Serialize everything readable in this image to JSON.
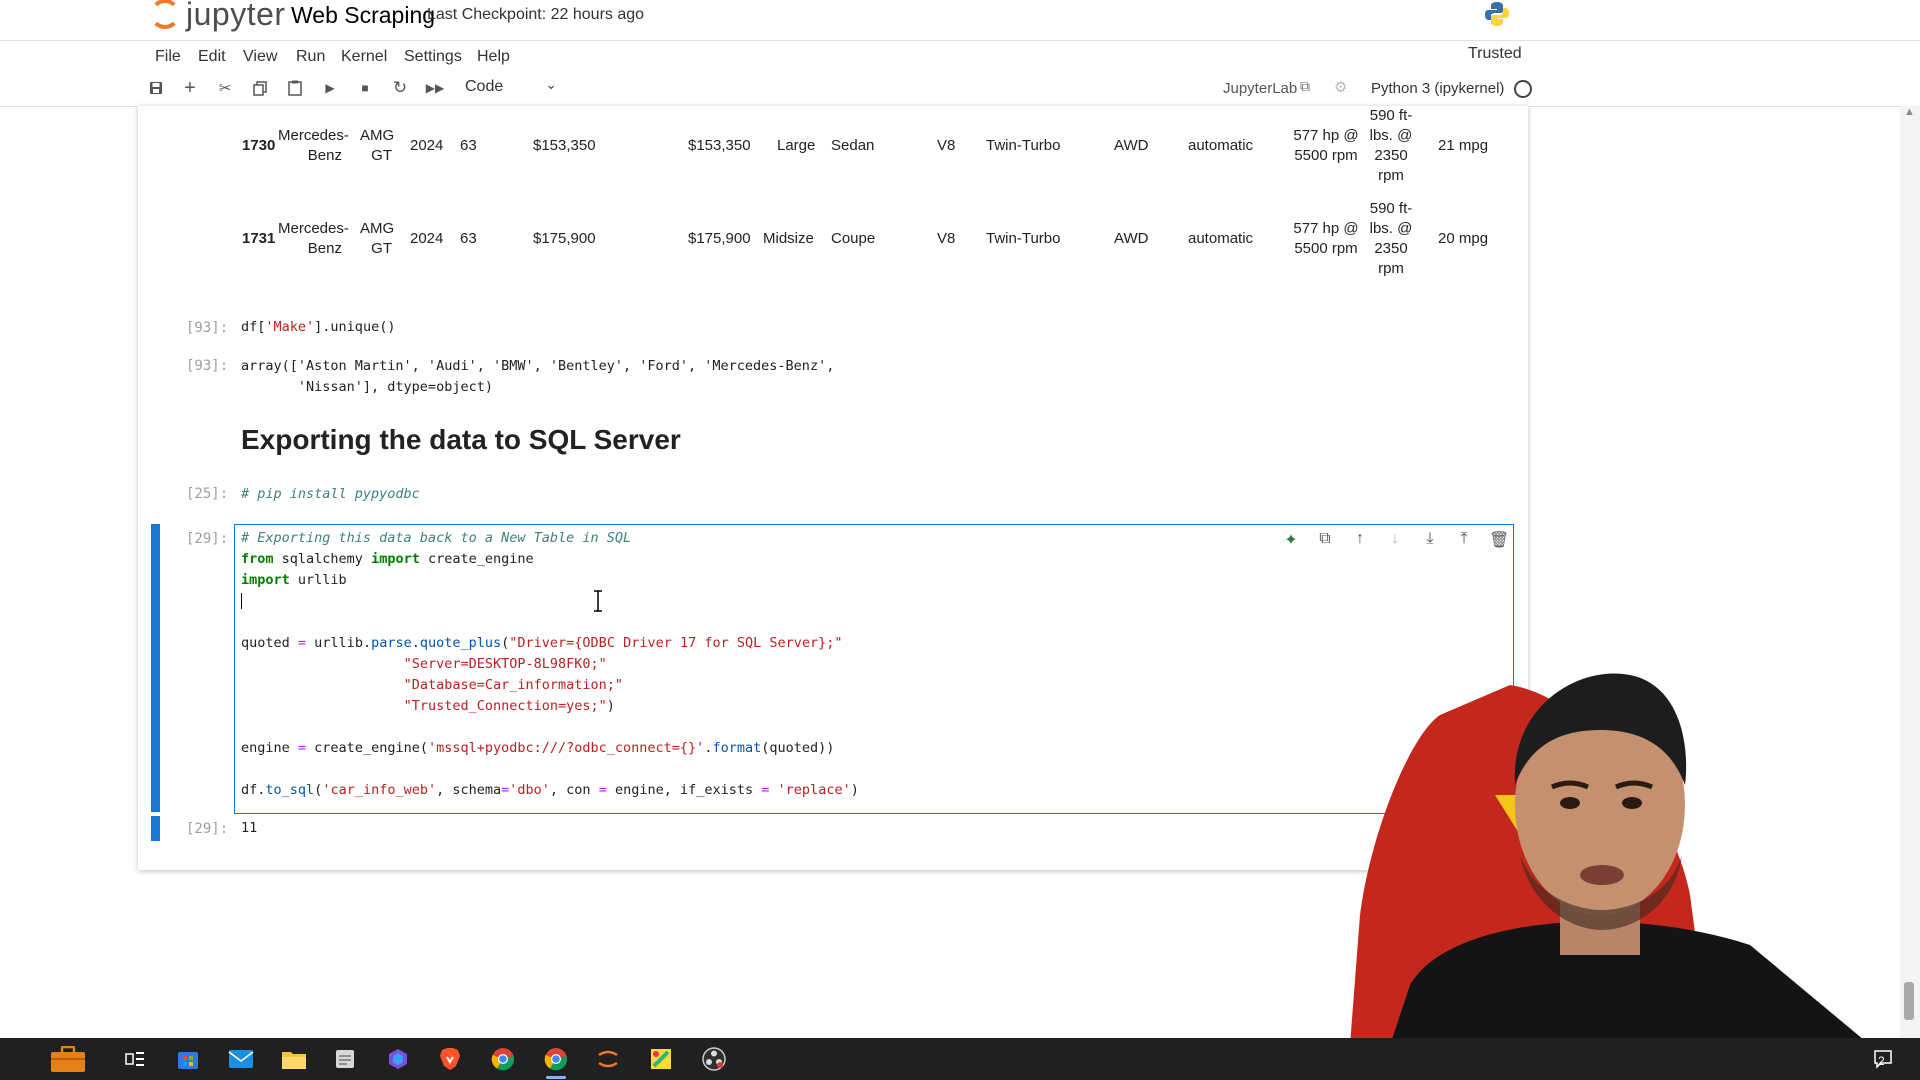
{
  "header": {
    "logo_text": "jupyter",
    "notebook_title": "Web Scraping",
    "checkpoint": "Last Checkpoint: 22 hours ago",
    "trusted": "Trusted"
  },
  "menu": [
    "File",
    "Edit",
    "View",
    "Run",
    "Kernel",
    "Settings",
    "Help"
  ],
  "toolbar": {
    "cell_type": "Code",
    "jupyterlab_label": "JupyterLab",
    "kernel_name": "Python 3 (ipykernel)",
    "icons": [
      "save-icon",
      "add-cell-icon",
      "cut-icon",
      "copy-icon",
      "paste-icon",
      "run-icon",
      "stop-icon",
      "restart-icon",
      "fast-forward-icon"
    ]
  },
  "table_rows": [
    {
      "index": "1730",
      "make": [
        "Mercedes-",
        "Benz"
      ],
      "model": [
        "AMG",
        "GT"
      ],
      "year": "2024",
      "col4": "63",
      "price1": "$153,350",
      "price2": "$153,350",
      "size": "Large",
      "style": "Sedan",
      "engine": "V8",
      "turbo": "Twin-Turbo",
      "drive": "AWD",
      "trans": "automatic",
      "hp": [
        "577 hp @",
        "5500 rpm"
      ],
      "torque": [
        "590 ft-",
        "lbs. @",
        "2350",
        "rpm"
      ],
      "mpg": "21 mpg"
    },
    {
      "index": "1731",
      "make": [
        "Mercedes-",
        "Benz"
      ],
      "model": [
        "AMG",
        "GT"
      ],
      "year": "2024",
      "col4": "63",
      "price1": "$175,900",
      "price2": "$175,900",
      "size": "Midsize",
      "style": "Coupe",
      "engine": "V8",
      "turbo": "Twin-Turbo",
      "drive": "AWD",
      "trans": "automatic",
      "hp": [
        "577 hp @",
        "5500 rpm"
      ],
      "torque": [
        "590 ft-",
        "lbs. @",
        "2350",
        "rpm"
      ],
      "mpg": "20 mpg"
    }
  ],
  "cells": {
    "c93_in_prompt": "[93]:",
    "c93_out_prompt": "[93]:",
    "c93_code_a": "df[",
    "c93_code_str": "'Make'",
    "c93_code_b": "].unique()",
    "c93_out_line1": "array(['Aston Martin', 'Audi', 'BMW', 'Bentley', 'Ford', 'Mercedes-Benz',",
    "c93_out_line2": "       'Nissan'], dtype=object)",
    "heading": "Exporting the data to SQL Server",
    "c25_prompt": "[25]:",
    "c25_code": "# pip install pypyodbc",
    "c29_prompt": "[29]:",
    "c29_out_prompt": "[29]:",
    "c29_output": "11",
    "c29_lines": {
      "l1": "# Exporting this data back to a New Table in SQL",
      "l2_kw1": "from",
      "l2_a": " sqlalchemy ",
      "l2_kw2": "import",
      "l2_b": " create_engine",
      "l3_kw": "import",
      "l3_a": " urllib",
      "l5_a": "quoted ",
      "l5_op": "=",
      "l5_b": " urllib.",
      "l5_fn1": "parse",
      "l5_c": ".",
      "l5_fn2": "quote_plus",
      "l5_d": "(",
      "l5_str": "\"Driver={ODBC Driver 17 for SQL Server};\"",
      "l6_str": "\"Server=DESKTOP-8L98FK0;\"",
      "l7_str": "\"Database=Car_information;\"",
      "l8_str": "\"Trusted_Connection=yes;\"",
      "l8_end": ")",
      "l10_a": "engine ",
      "l10_op": "=",
      "l10_b": " create_engine(",
      "l10_str": "'mssql+pyodbc:///?odbc_connect={}'",
      "l10_c": ".",
      "l10_fn": "format",
      "l10_d": "(quoted))",
      "l12_a": "df.",
      "l12_fn": "to_sql",
      "l12_b": "(",
      "l12_s1": "'car_info_web'",
      "l12_c": ", schema",
      "l12_op1": "=",
      "l12_s2": "'dbo'",
      "l12_d": ", con ",
      "l12_op2": "=",
      "l12_e": " engine, if_exists ",
      "l12_op3": "=",
      "l12_s3": " 'replace'",
      "l12_f": ")"
    }
  },
  "taskbar": {
    "notification_count": "2",
    "apps": [
      "files-app-icon",
      "task-view-icon",
      "store-icon",
      "mail-icon",
      "file-explorer-icon",
      "notepad-icon",
      "copilot-icon",
      "brave-icon",
      "chrome-icon",
      "chrome-active-icon",
      "jupyter-app-icon",
      "paint-icon",
      "obs-icon"
    ]
  }
}
